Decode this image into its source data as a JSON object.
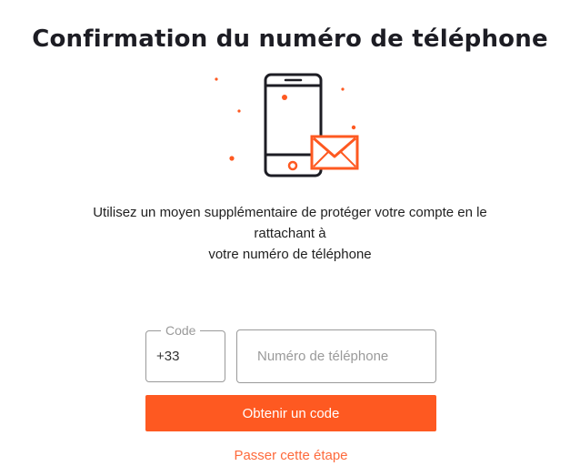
{
  "page": {
    "title": "Confirmation du numéro de téléphone",
    "description_lines": [
      "Utilisez un moyen supplémentaire de protéger votre compte en le",
      "rattachant à",
      "votre numéro de téléphone"
    ]
  },
  "illustration": {
    "icons": [
      "smartphone-icon",
      "envelope-icon"
    ],
    "accent_color": "#fe5921",
    "outline_color": "#1d1d24"
  },
  "form": {
    "code_label": "Code",
    "code_value": "+33",
    "phone_placeholder": "Numéro de téléphone",
    "submit_label": "Obtenir un code",
    "skip_label": "Passer cette étape"
  },
  "colors": {
    "primary": "#fe5921",
    "link": "#fe6a3c",
    "text": "#1f1f1f",
    "border": "#9a9a9a"
  }
}
